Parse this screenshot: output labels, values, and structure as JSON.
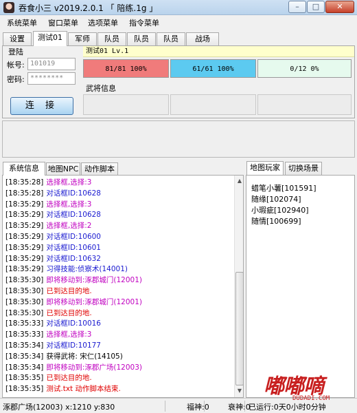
{
  "window": {
    "title": "吞食小三 v2019.2.0.1 「 陪练.1g 」"
  },
  "menu": [
    "系统菜单",
    "窗口菜单",
    "选项菜单",
    "指令菜单"
  ],
  "tabs": [
    "设置",
    "测试01",
    "军师",
    "队员",
    "队员",
    "队员",
    "战场"
  ],
  "login": {
    "legend": "登陆",
    "account_label": "帐号:",
    "account_value": "101019",
    "password_label": "密码:",
    "password_value": "********",
    "connect_label": "连 接"
  },
  "character": {
    "header": "测试01 Lv.1",
    "hp_text": "81/81 100%",
    "mp_text": "61/61 100%",
    "exp_text": "0/12 0%",
    "hp_fraction": 1.0,
    "mp_fraction": 1.0,
    "exp_fraction": 0.0,
    "skills_legend": "武将信息"
  },
  "colors": {
    "hp": "#f07b7b",
    "mp": "#5ccaf0",
    "exp": "#a6efc4",
    "log_blue": "#1a1ad0",
    "log_purple": "#c000c0",
    "log_red": "#e00000",
    "log_black": "#000000"
  },
  "log_tabs": [
    "系统信息",
    "地图NPC",
    "动作脚本"
  ],
  "log": [
    {
      "time": "[18:35:28]",
      "text": "选择框,选择:3",
      "color": "purple"
    },
    {
      "time": "[18:35:28]",
      "text": "对话框ID:10628",
      "color": "blue"
    },
    {
      "time": "[18:35:29]",
      "text": "选择框,选择:3",
      "color": "purple"
    },
    {
      "time": "[18:35:29]",
      "text": "对话框ID:10628",
      "color": "blue"
    },
    {
      "time": "[18:35:29]",
      "text": "选择框,选择:2",
      "color": "purple"
    },
    {
      "time": "[18:35:29]",
      "text": "对话框ID:10600",
      "color": "blue"
    },
    {
      "time": "[18:35:29]",
      "text": "对话框ID:10601",
      "color": "blue"
    },
    {
      "time": "[18:35:29]",
      "text": "对话框ID:10632",
      "color": "blue"
    },
    {
      "time": "[18:35:29]",
      "text": "习得技能:侦察术(14001)",
      "color": "blue"
    },
    {
      "time": "[18:35:30]",
      "text": "即将移动到:涿郡城门(12001)",
      "color": "purple"
    },
    {
      "time": "[18:35:30]",
      "text": "已到达目的地.",
      "color": "red"
    },
    {
      "time": "[18:35:30]",
      "text": "即将移动到:涿郡城门(12001)",
      "color": "purple"
    },
    {
      "time": "[18:35:30]",
      "text": "已到达目的地.",
      "color": "red"
    },
    {
      "time": "[18:35:33]",
      "text": "对话框ID:10016",
      "color": "blue"
    },
    {
      "time": "[18:35:33]",
      "text": "选择框,选择:3",
      "color": "purple"
    },
    {
      "time": "[18:35:34]",
      "text": "对话框ID:10177",
      "color": "blue"
    },
    {
      "time": "[18:35:34]",
      "text": "获得武将: 宋仁(14105)",
      "color": "black"
    },
    {
      "time": "[18:35:34]",
      "text": "即将移动到:涿郡广场(12003)",
      "color": "purple"
    },
    {
      "time": "[18:35:35]",
      "text": "已到达目的地.",
      "color": "red"
    },
    {
      "time": "[18:35:35]",
      "text": "测试.txt 动作脚本结束.",
      "color": "red"
    }
  ],
  "player_tabs": [
    "地图玩家",
    "切换场景"
  ],
  "players": [
    "蜡笔小薯[101591]",
    "随缘[102074]",
    "小瑕疵[102940]",
    "随情[100699]"
  ],
  "status": {
    "location": "涿郡广场(12003) x:1210 y:830",
    "fortune": "福神:0",
    "decline": "衰神:0",
    "runtime": "已运行:0天0小时0分钟"
  },
  "watermark": {
    "text": "嘟嘟嘀",
    "sub": "DUDADI.COM"
  }
}
